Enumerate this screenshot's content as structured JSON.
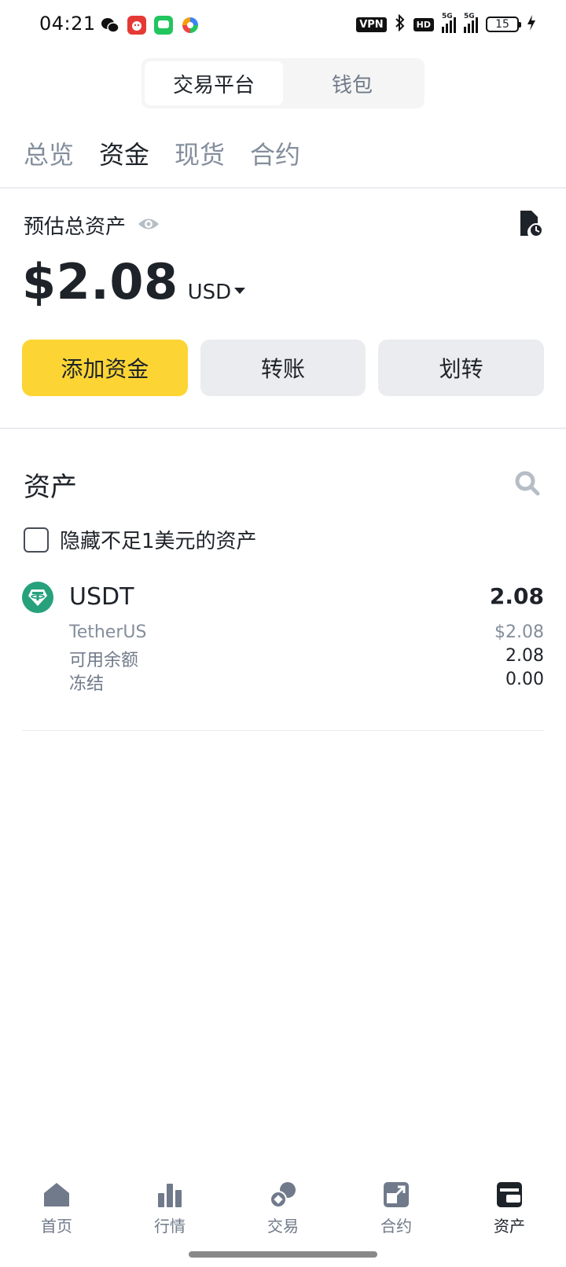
{
  "status_bar": {
    "time": "04:21",
    "vpn": "VPN",
    "hd": "HD",
    "signal_1": "5G",
    "signal_2": "5G",
    "battery": "15"
  },
  "segment": {
    "items": [
      {
        "label": "交易平台",
        "active": true
      },
      {
        "label": "钱包",
        "active": false
      }
    ]
  },
  "subtabs": [
    {
      "label": "总览",
      "active": false
    },
    {
      "label": "资金",
      "active": true
    },
    {
      "label": "现货",
      "active": false
    },
    {
      "label": "合约",
      "active": false
    }
  ],
  "overview": {
    "est_label": "预估总资产",
    "balance": "$2.08",
    "currency": "USD"
  },
  "actions": {
    "add_funds": "添加资金",
    "send": "转账",
    "transfer": "划转"
  },
  "assets": {
    "title": "资产",
    "hide_small_label": "隐藏不足1美元的资产",
    "items": [
      {
        "symbol": "USDT",
        "name": "TetherUS",
        "amount": "2.08",
        "value": "$2.08",
        "available_label": "可用余额",
        "available": "2.08",
        "frozen_label": "冻结",
        "frozen": "0.00"
      }
    ]
  },
  "bottom_nav": [
    {
      "label": "首页",
      "icon": "home-icon"
    },
    {
      "label": "行情",
      "icon": "markets-icon"
    },
    {
      "label": "交易",
      "icon": "trade-icon"
    },
    {
      "label": "合约",
      "icon": "futures-icon"
    },
    {
      "label": "资产",
      "icon": "wallet-icon",
      "active": true
    }
  ],
  "colors": {
    "accent_yellow": "#fcd535",
    "tether_green": "#26a17b",
    "text_primary": "#1e2329",
    "text_secondary": "#848e9c"
  }
}
